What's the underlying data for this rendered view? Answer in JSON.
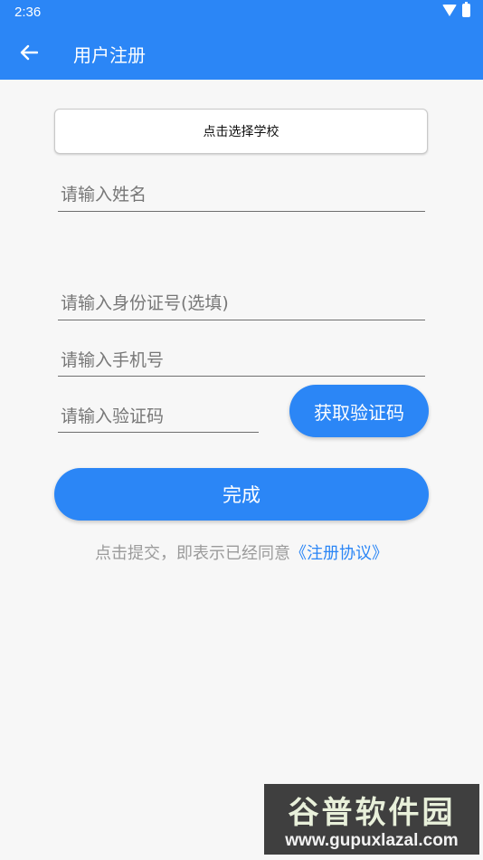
{
  "status_bar": {
    "time": "2:36"
  },
  "appbar": {
    "title": "用户注册"
  },
  "school_button": {
    "label": "点击选择学校"
  },
  "fields": {
    "name": "请输入姓名",
    "id_card": "请输入身份证号(选填)",
    "phone": "请输入手机号",
    "code": "请输入验证码"
  },
  "get_code_button": {
    "label": "获取验证码"
  },
  "submit_button": {
    "label": "完成"
  },
  "agreement": {
    "text": "点击提交，即表示已经同意",
    "link": "《注册协议》"
  },
  "watermark": {
    "title": "谷普软件园",
    "url": "www.gupuxlazal.com"
  },
  "colors": {
    "primary": "#2b86f6",
    "background": "#f7f7f7"
  }
}
